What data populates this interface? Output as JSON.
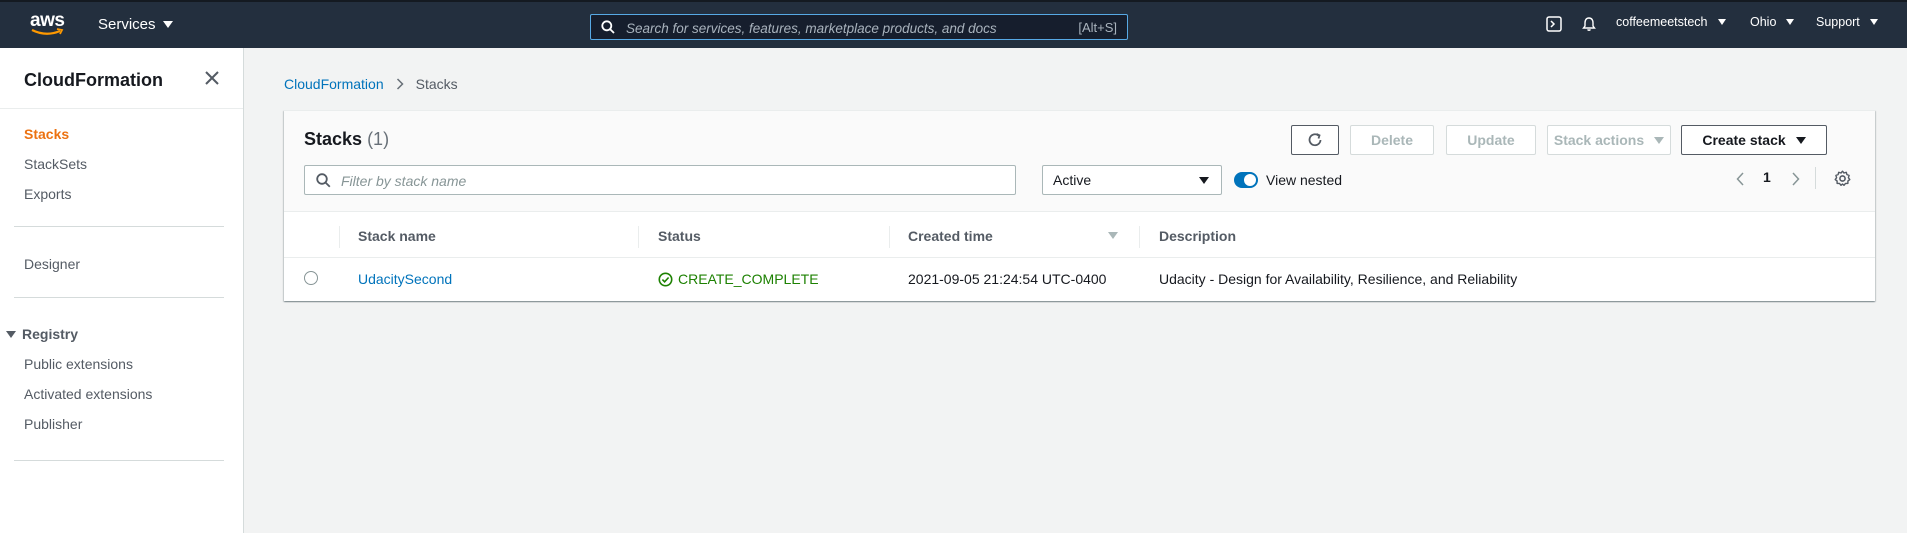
{
  "topnav": {
    "logo": "aws",
    "services_label": "Services",
    "search_placeholder": "Search for services, features, marketplace products, and docs",
    "search_shortcut": "[Alt+S]",
    "account": "coffeemeetstech",
    "region": "Ohio",
    "support": "Support"
  },
  "sidebar": {
    "title": "CloudFormation",
    "items": [
      {
        "label": "Stacks",
        "active": true
      },
      {
        "label": "StackSets"
      },
      {
        "label": "Exports"
      }
    ],
    "designer": "Designer",
    "registry": {
      "label": "Registry",
      "items": [
        "Public extensions",
        "Activated extensions",
        "Publisher"
      ]
    }
  },
  "breadcrumb": {
    "root": "CloudFormation",
    "current": "Stacks"
  },
  "panel": {
    "title": "Stacks",
    "count": "(1)",
    "buttons": {
      "delete": "Delete",
      "update": "Update",
      "stack_actions": "Stack actions",
      "create_stack": "Create stack"
    },
    "filter_placeholder": "Filter by stack name",
    "status_filter": "Active",
    "view_nested": "View nested",
    "page": "1",
    "columns": [
      "Stack name",
      "Status",
      "Created time",
      "Description"
    ],
    "rows": [
      {
        "stack_name": "UdacitySecond",
        "status": "CREATE_COMPLETE",
        "created": "2021-09-05 21:24:54 UTC-0400",
        "description": "Udacity - Design for Availability, Resilience, and Reliability"
      }
    ]
  },
  "colors": {
    "nav_bg": "#232f3e",
    "link": "#0073bb",
    "active": "#ec7211",
    "success": "#1d8102"
  }
}
